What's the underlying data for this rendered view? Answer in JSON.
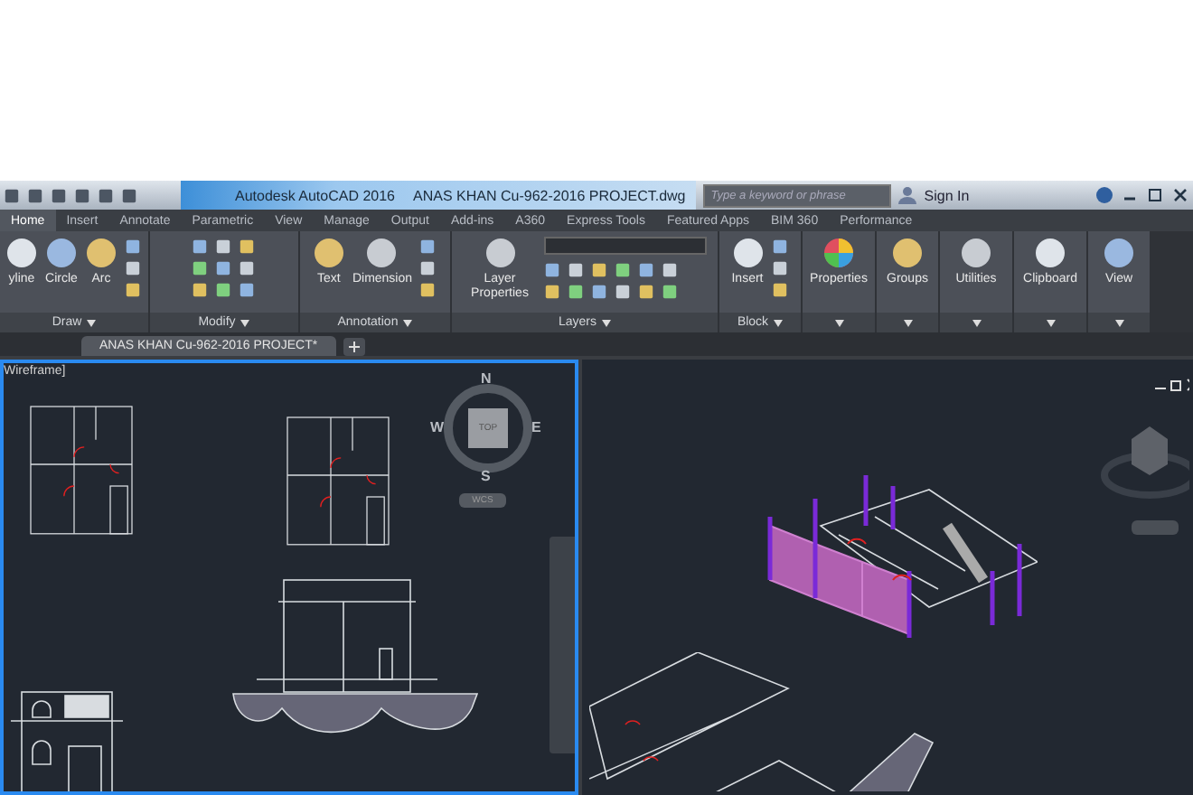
{
  "title_bar": {
    "app_title": "Autodesk AutoCAD 2016",
    "file_title": "ANAS KHAN Cu-962-2016 PROJECT.dwg",
    "search": {
      "placeholder": "Type a keyword or phrase"
    },
    "sign_in": "Sign In"
  },
  "ribbon_tabs": [
    {
      "label": "Home",
      "selected": true
    },
    {
      "label": "Insert",
      "selected": false
    },
    {
      "label": "Annotate",
      "selected": false
    },
    {
      "label": "Parametric",
      "selected": false
    },
    {
      "label": "View",
      "selected": false
    },
    {
      "label": "Manage",
      "selected": false
    },
    {
      "label": "Output",
      "selected": false
    },
    {
      "label": "Add-ins",
      "selected": false
    },
    {
      "label": "A360",
      "selected": false
    },
    {
      "label": "Express Tools",
      "selected": false
    },
    {
      "label": "Featured Apps",
      "selected": false
    },
    {
      "label": "BIM 360",
      "selected": false
    },
    {
      "label": "Performance",
      "selected": false
    }
  ],
  "ribbon_panels": [
    {
      "kind": "tools",
      "title": "Draw",
      "buttons": [
        "yline",
        "Circle",
        "Arc"
      ]
    },
    {
      "kind": "grid",
      "title": "Modify"
    },
    {
      "kind": "tools",
      "title": "Annotation",
      "buttons": [
        "Text",
        "Dimension"
      ]
    },
    {
      "kind": "layers",
      "title": "Layers",
      "buttons": [
        "Layer Properties"
      ]
    },
    {
      "kind": "tools",
      "title": "Block",
      "buttons": [
        "Insert"
      ]
    },
    {
      "kind": "single",
      "buttons": [
        "Properties"
      ]
    },
    {
      "kind": "single",
      "buttons": [
        "Groups"
      ]
    },
    {
      "kind": "single",
      "buttons": [
        "Utilities"
      ]
    },
    {
      "kind": "single",
      "buttons": [
        "Clipboard"
      ]
    },
    {
      "kind": "single",
      "buttons": [
        "View"
      ]
    }
  ],
  "document_tabs": [
    {
      "label": "ANAS KHAN Cu-962-2016 PROJECT*",
      "selected": true
    }
  ],
  "viewports": [
    {
      "kind": "plan",
      "active": true,
      "label": "Wireframe]",
      "compass": {
        "north": "N",
        "south": "S",
        "east": "E",
        "west": "W",
        "top": "TOP",
        "ucs": "WCS"
      }
    },
    {
      "kind": "iso",
      "active": false
    }
  ]
}
